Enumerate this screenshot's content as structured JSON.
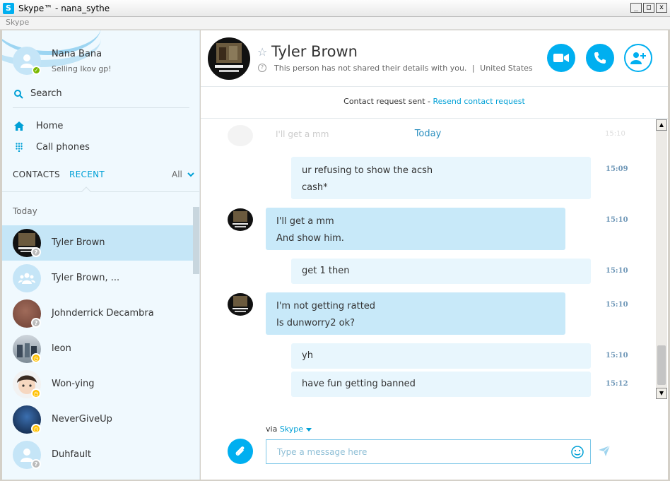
{
  "window": {
    "title": "Skype™ - nana_sythe",
    "menu_label": "Skype",
    "btn_min": "_",
    "btn_max": "□",
    "btn_close": "x"
  },
  "me": {
    "name": "Nana Bana",
    "mood": "Selling Ikov gp!"
  },
  "sidebar": {
    "search_label": "Search",
    "home_label": "Home",
    "call_phones_label": "Call phones",
    "tab_contacts": "CONTACTS",
    "tab_recent": "RECENT",
    "filter_label": "All",
    "today_label": "Today",
    "contacts": [
      {
        "name": "Tyler Brown",
        "status": "unknown",
        "active": true
      },
      {
        "name": "Tyler Brown, ...",
        "status": "group",
        "active": false
      },
      {
        "name": "Johnderrick Decambra",
        "status": "unknown",
        "active": false
      },
      {
        "name": "leon",
        "status": "away",
        "active": false
      },
      {
        "name": "Won-ying",
        "status": "away",
        "active": false
      },
      {
        "name": "NeverGiveUp",
        "status": "away",
        "active": false
      },
      {
        "name": "Duhfault",
        "status": "unknown",
        "active": false
      }
    ]
  },
  "conversation": {
    "name": "Tyler Brown",
    "info": "This person has not shared their details with you.",
    "separator": "|",
    "location": "United States",
    "request_text": "Contact request sent -",
    "request_link": "Resend contact request",
    "today_label": "Today",
    "ghost_text": "I'll get a mm",
    "ghost_time": "15:10",
    "messages": [
      {
        "lines": [
          "ur refusing to show the acsh",
          "cash*"
        ],
        "time": "15:09",
        "direction": "out"
      },
      {
        "lines": [
          "I'll get a mm",
          "And show him."
        ],
        "time": "15:10",
        "direction": "in"
      },
      {
        "lines": [
          "get 1 then"
        ],
        "time": "15:10",
        "direction": "out"
      },
      {
        "lines": [
          "I'm not getting ratted",
          "Is dunworry2 ok?"
        ],
        "time": "15:10",
        "direction": "in"
      },
      {
        "lines": [
          "yh"
        ],
        "time": "15:10",
        "direction": "out"
      },
      {
        "lines": [
          "have fun getting banned"
        ],
        "time": "15:12",
        "direction": "out"
      }
    ]
  },
  "composer": {
    "via_prefix": "via",
    "via_service": "Skype",
    "placeholder": "Type a message here"
  },
  "colors": {
    "accent": "#00aff0",
    "link": "#00a0d6",
    "bubble_out": "#e8f6fd",
    "bubble_in": "#c8e9f9",
    "online": "#7bb800",
    "away": "#ffc000"
  }
}
